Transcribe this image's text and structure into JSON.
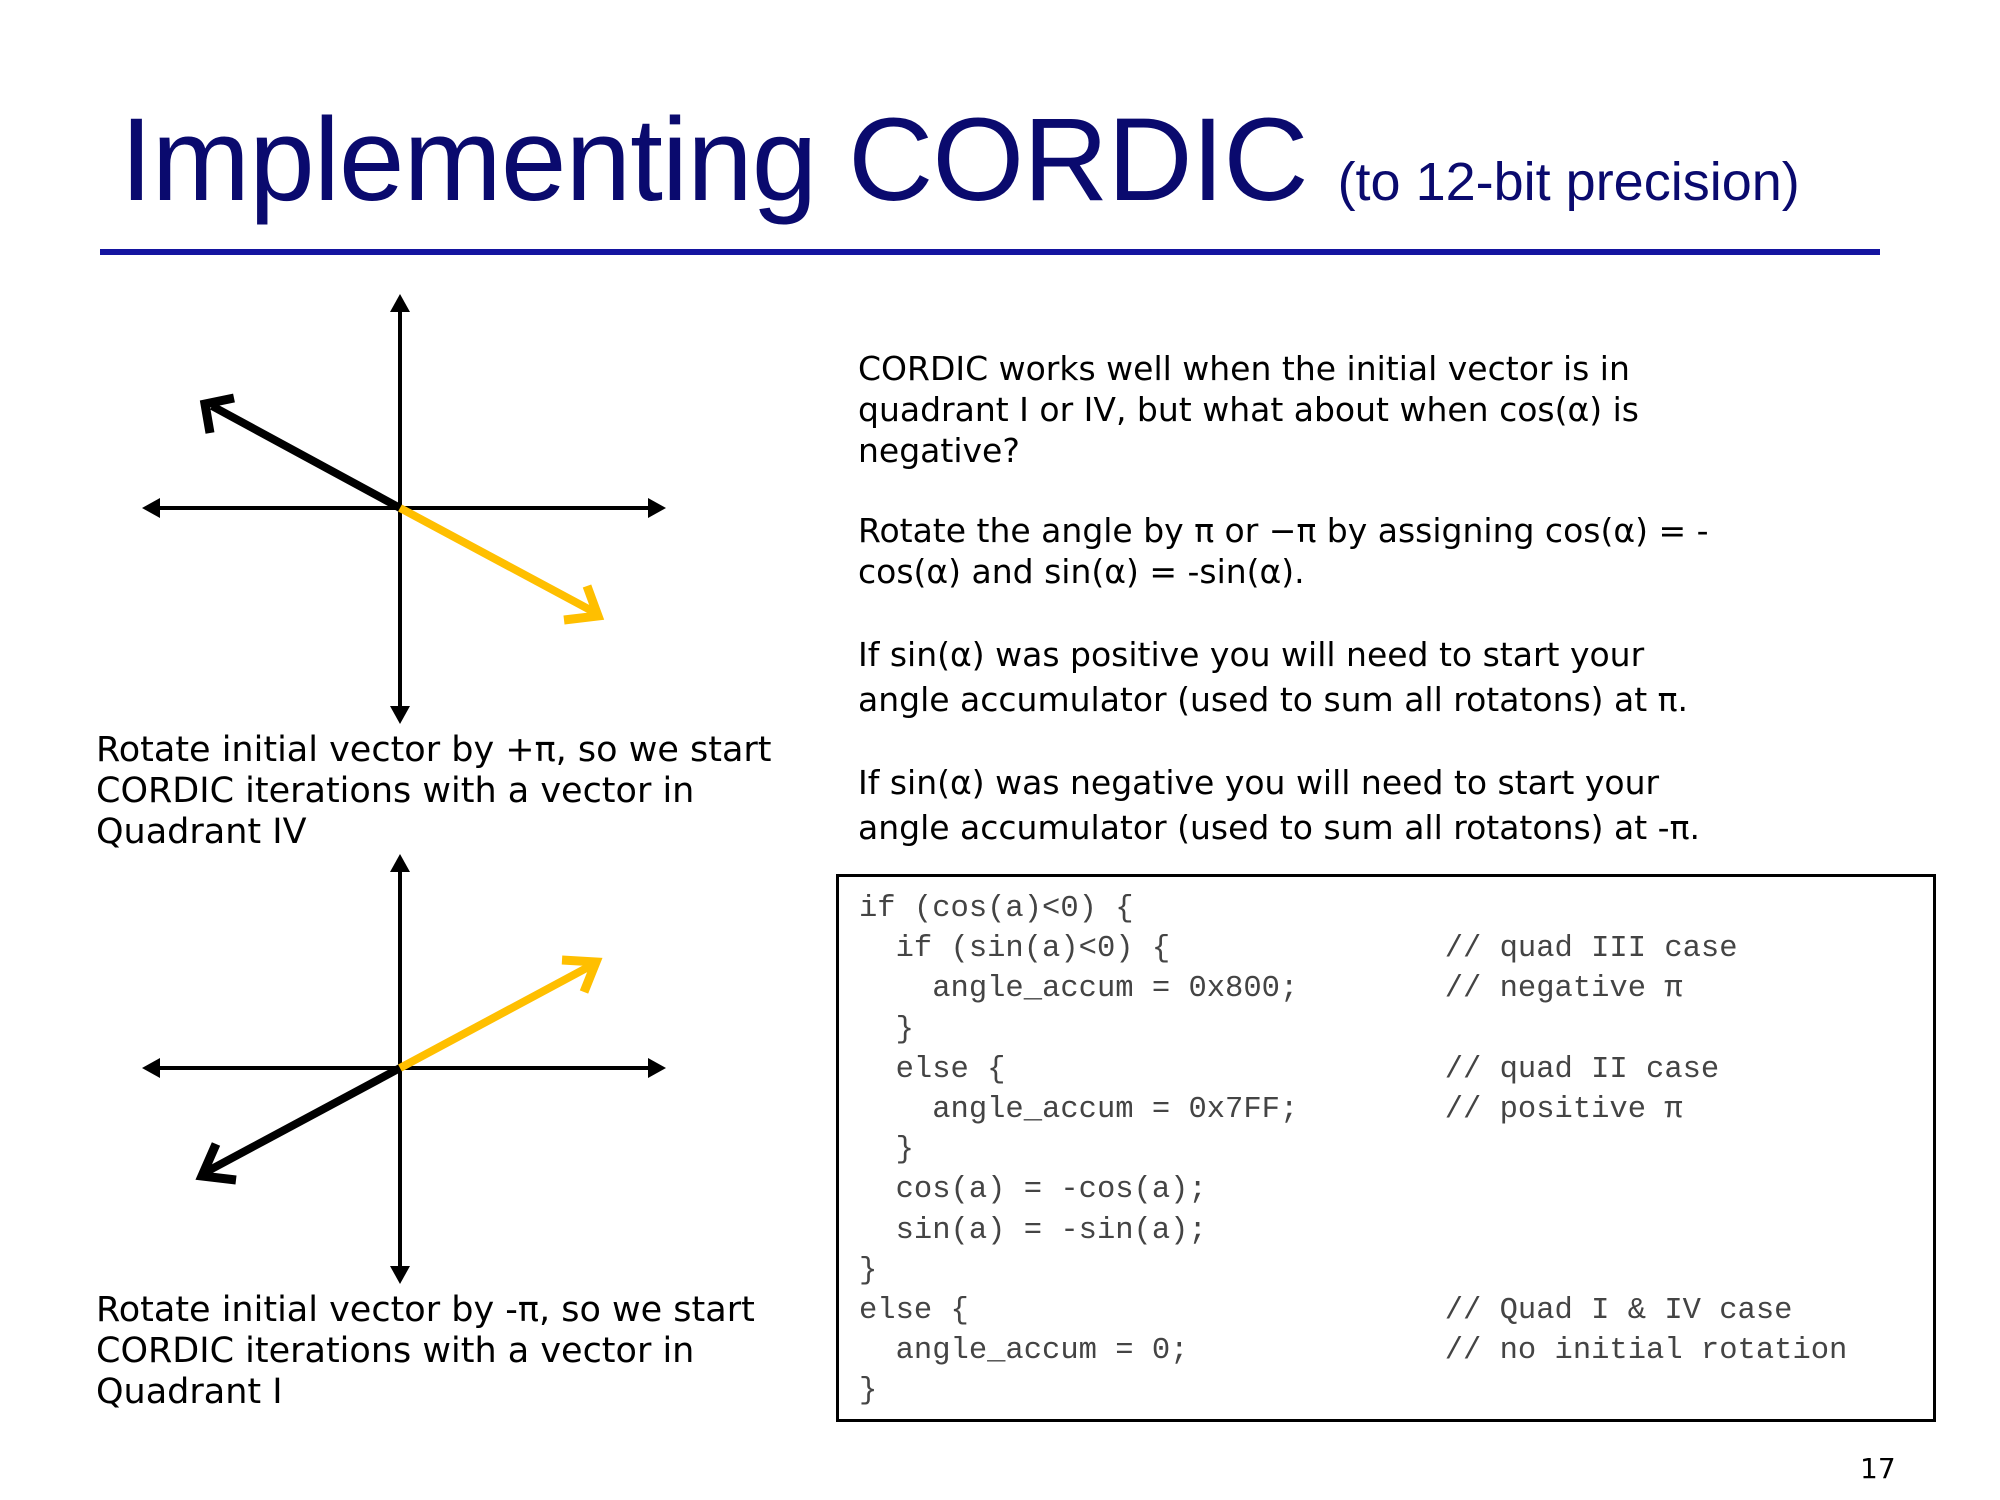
{
  "slide": {
    "title": "Implementing CORDIC",
    "subtitle": "(to 12-bit precision)",
    "page_number": "17"
  },
  "captions": {
    "top": [
      "Rotate initial vector by +π, so we start",
      "CORDIC iterations with a vector in",
      "Quadrant IV"
    ],
    "bottom": [
      "Rotate initial vector by -π, so we start",
      "CORDIC iterations with a vector in",
      "Quadrant I"
    ]
  },
  "paragraphs": [
    [
      "CORDIC works well when the initial vector is in",
      "quadrant I or IV, but what about when cos(α) is",
      "negative?"
    ],
    [
      "Rotate the angle by π or −π by assigning cos(α) = -",
      "cos(α) and sin(α) = -sin(α)."
    ],
    [
      "If sin(α) was positive you will need to start your",
      "angle accumulator (used to sum all rotatons) at π."
    ],
    [
      "If sin(α) was negative you will need to start your",
      "angle accumulator (used to sum all rotatons) at -π."
    ]
  ],
  "code_lines": [
    "if (cos(a)<0) {",
    "  if (sin(a)<0) {               // quad III case",
    "    angle_accum = 0x800;        // negative π",
    "  }",
    "  else {                        // quad II case",
    "    angle_accum = 0x7FF;        // positive π",
    "  }",
    "  cos(a) = -cos(a);",
    "  sin(a) = -sin(a);",
    "}",
    "else {                          // Quad I & IV case",
    "  angle_accum = 0;              // no initial rotation",
    "}"
  ],
  "colors": {
    "title": "#0a0a6e",
    "rule": "#1414a0",
    "vector_rotated": "#ffbf00",
    "vector_initial": "#000000"
  }
}
